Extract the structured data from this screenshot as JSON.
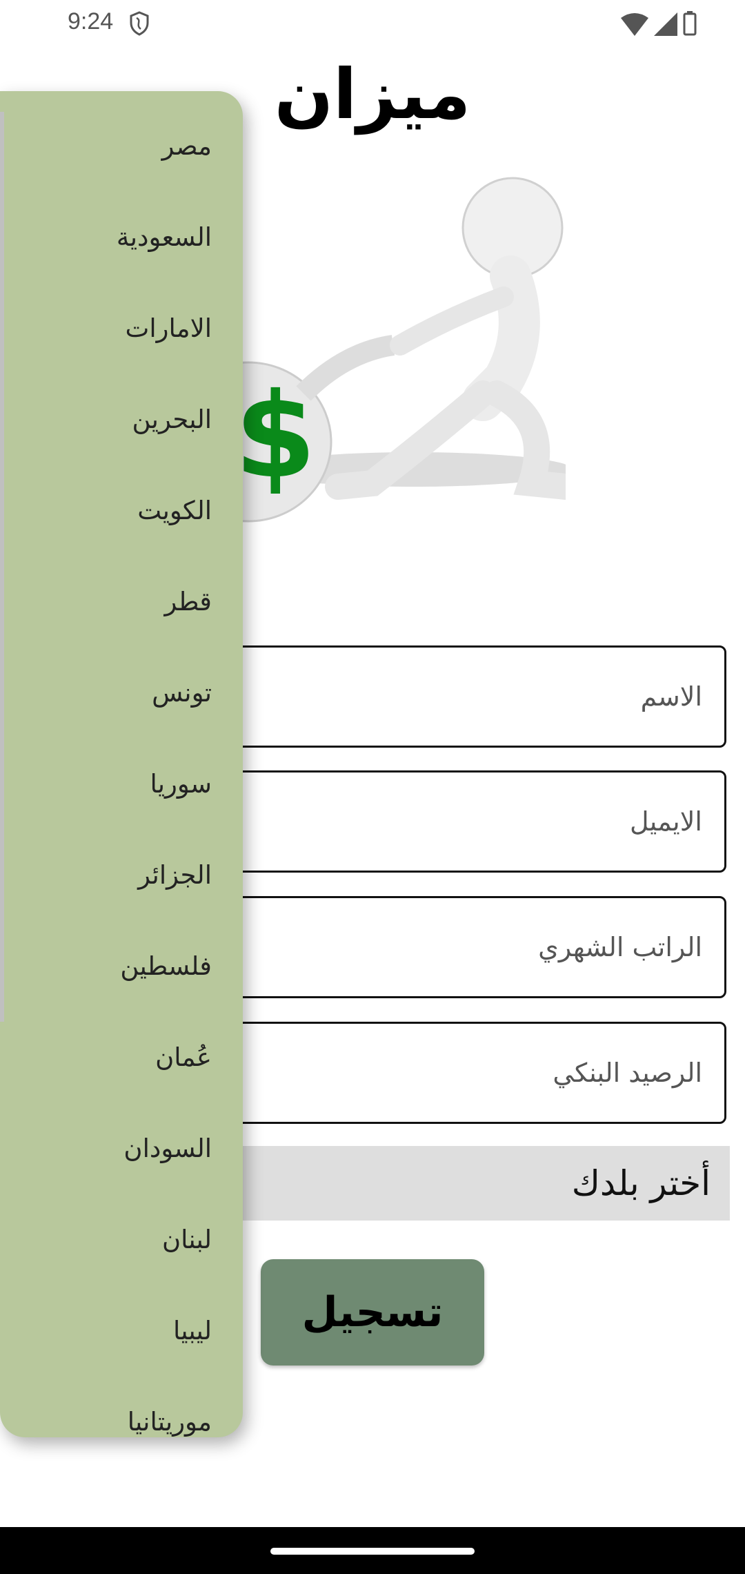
{
  "status_bar": {
    "time": "9:24"
  },
  "app": {
    "title": "ميزان"
  },
  "form": {
    "name_placeholder": "الاسم",
    "email_placeholder": "الايميل",
    "salary_placeholder": "الراتب الشهري",
    "balance_placeholder": "الرصيد البنكي",
    "country_spinner": "أختر بلدك",
    "register_button": "تسجيل"
  },
  "dropdown": {
    "items": [
      "مصر",
      "السعودية",
      "الامارات",
      "البحرين",
      "الكويت",
      "قطر",
      "تونس",
      "سوريا",
      "الجزائر",
      "فلسطين",
      "عُمان",
      "السودان",
      "لبنان",
      "ليبيا",
      "موريتانيا"
    ]
  },
  "colors": {
    "dropdown_bg": "#b8c89c",
    "button_bg": "#6f8a72",
    "spinner_bg": "#dedede"
  }
}
